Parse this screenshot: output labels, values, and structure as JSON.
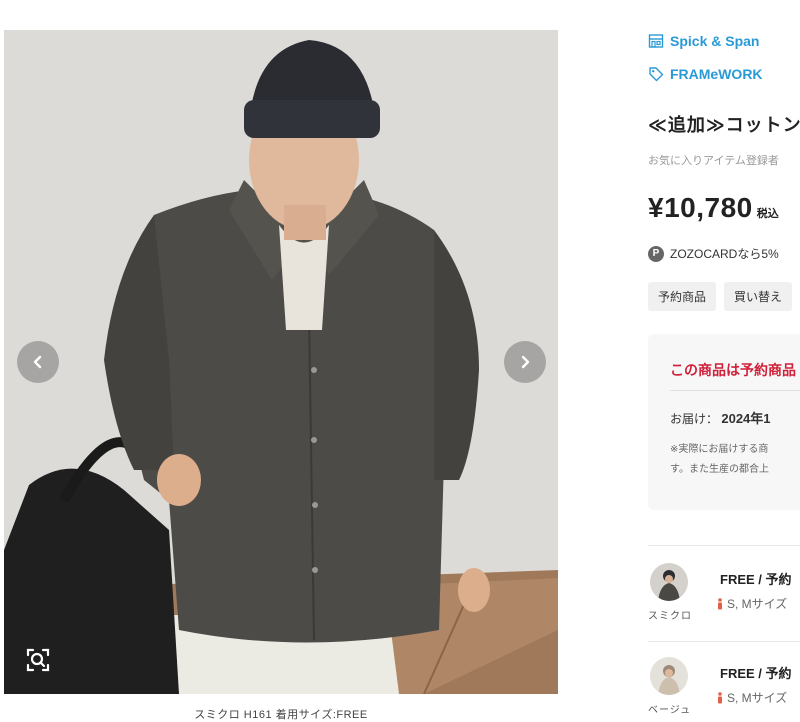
{
  "gallery": {
    "caption": "スミクロ H161 着用サイズ:FREE",
    "prev_icon": "chevron-left-icon",
    "next_icon": "chevron-right-icon",
    "zoom_icon": "zoom-search-icon"
  },
  "product": {
    "shop_name": "Spick & Span",
    "brand_name": "FRAMeWORK",
    "title": "≪追加≫コットン",
    "favorite_note": "お気に入りアイテム登録者",
    "price": "¥10,780",
    "tax_label": "税込",
    "card_badge": "P",
    "card_text": "ZOZOCARDなら5%",
    "tags": [
      "予約商品",
      "買い替え"
    ]
  },
  "notice": {
    "title": "この商品は予約商品",
    "delivery_label": "お届け：",
    "delivery_value": "2024年1",
    "note_line1": "※実際にお届けする商",
    "note_line2": "す。また生産の都合上"
  },
  "staff": [
    {
      "name": "スミクロ",
      "size": "FREE / 予約",
      "fit": "S, Mサイズ"
    },
    {
      "name": "ベージュ",
      "size": "FREE / 予約",
      "fit": "S, Mサイズ"
    }
  ],
  "colors": {
    "link_blue": "#2a9ad6",
    "notice_red": "#d0203a",
    "shirt": "#4d4b47",
    "fit_icon": "#e0604a"
  }
}
